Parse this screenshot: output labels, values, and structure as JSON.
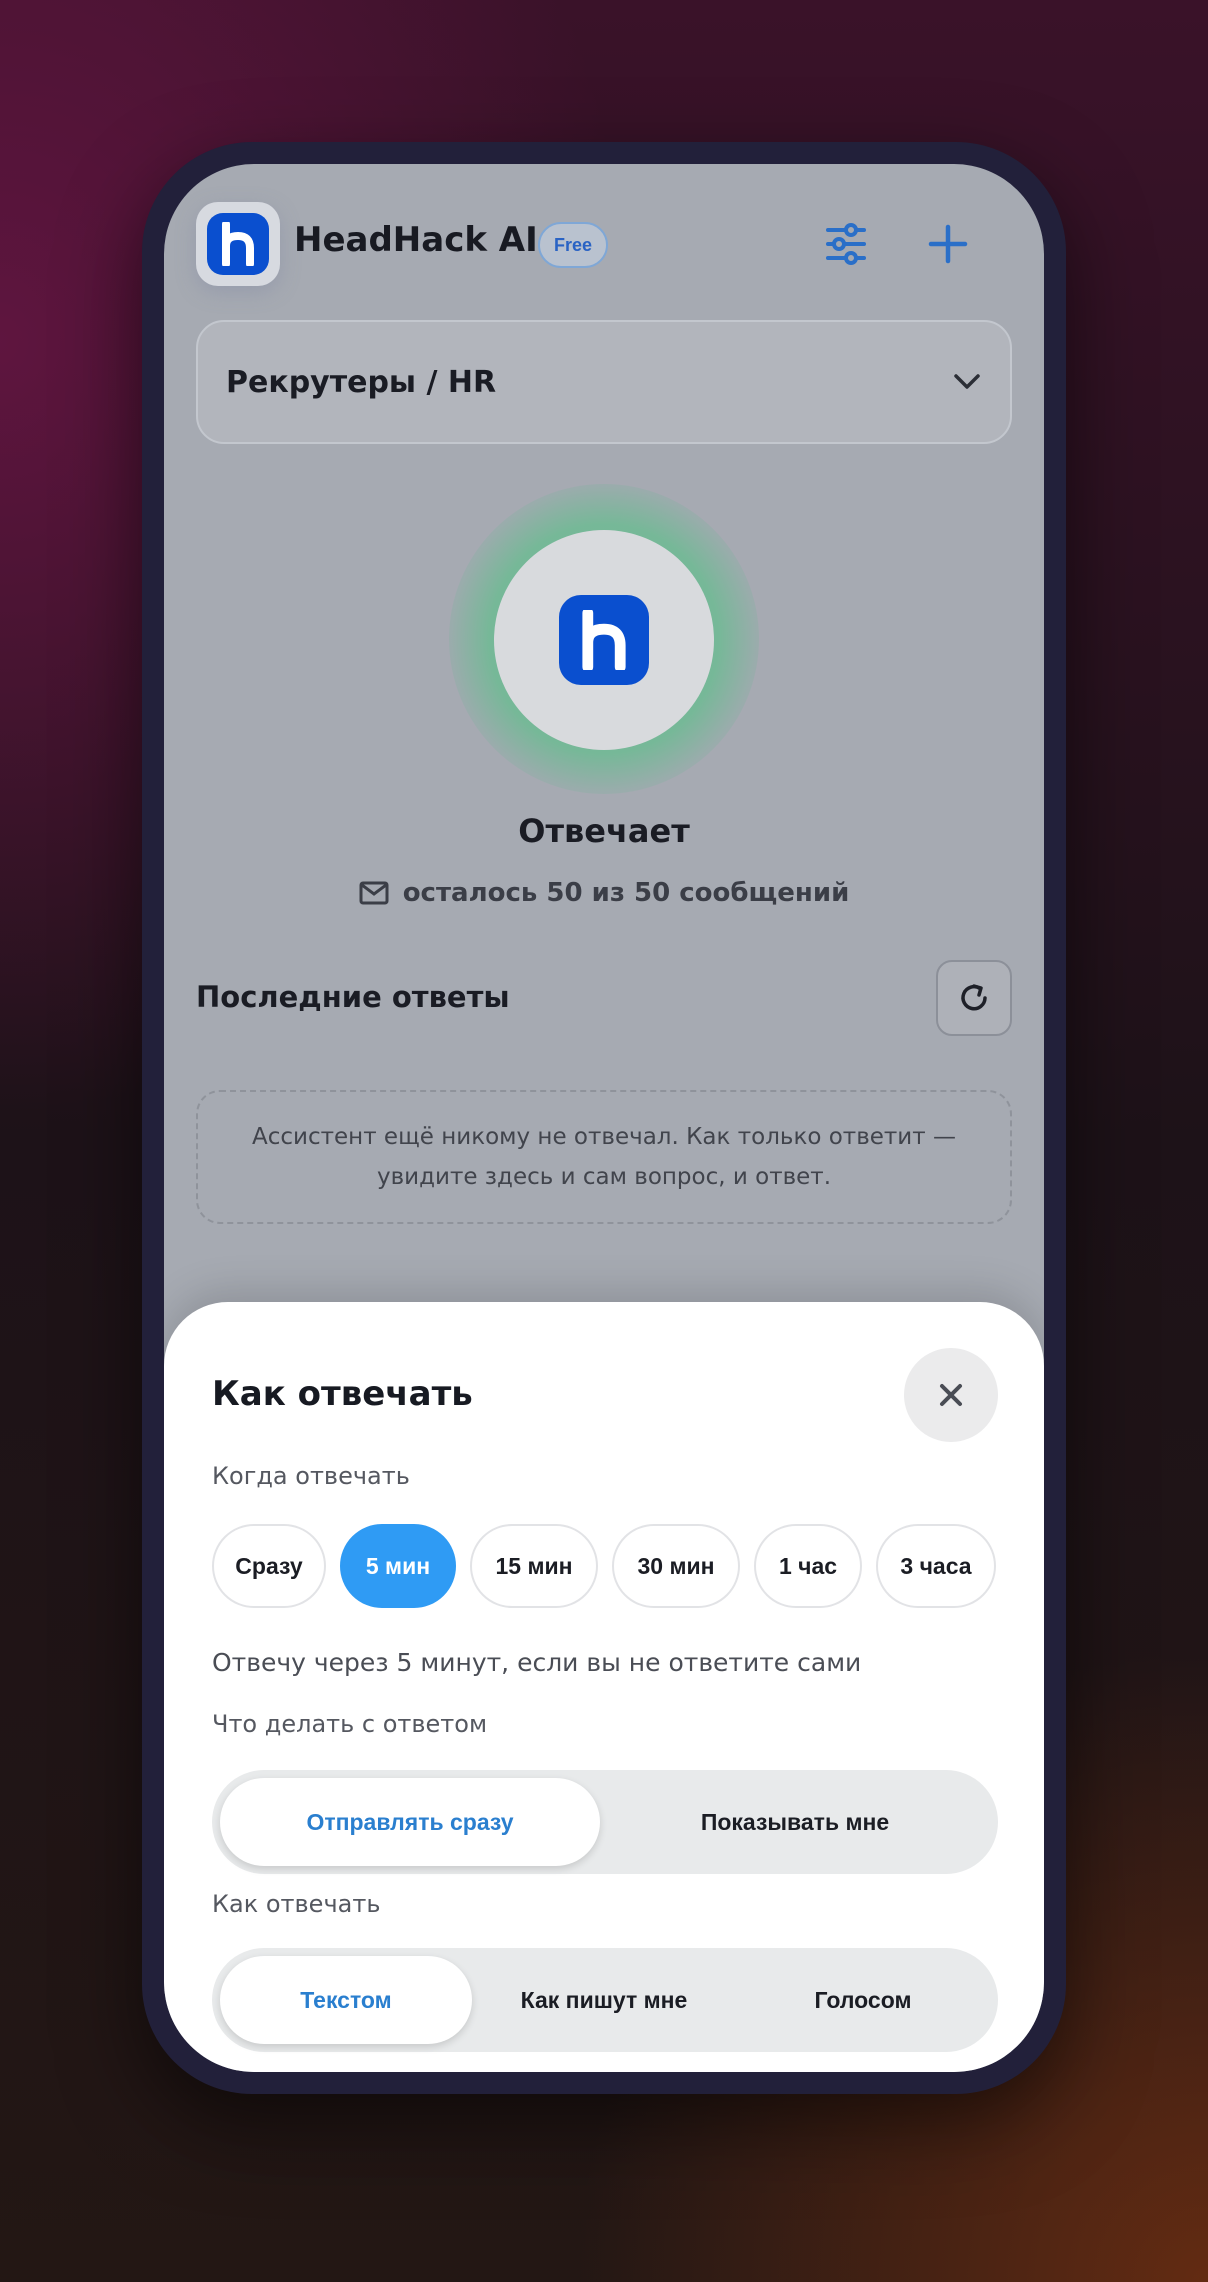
{
  "app": {
    "title": "HeadHack AI",
    "plan_badge": "Free",
    "logo_letter": "h"
  },
  "header": {
    "icons": [
      "settings-sliders-icon",
      "plus-icon"
    ]
  },
  "category_select": {
    "value": "Рекрутеры / HR",
    "icon": "chevron-down-icon"
  },
  "status": {
    "label": "Отвечает",
    "quota_text": "осталось 50 из 50 сообщений",
    "quota_icon": "mail-icon"
  },
  "recent": {
    "title": "Последние ответы",
    "refresh_icon": "refresh-icon",
    "empty_text": "Ассистент ещё никому не отвечал. Как только ответит — увидите здесь и сам вопрос, и ответ."
  },
  "sheet": {
    "title": "Как отвечать",
    "close_icon": "close-icon",
    "when_label": "Когда отвечать",
    "delay_options": [
      {
        "label": "Сразу",
        "selected": false
      },
      {
        "label": "5 мин",
        "selected": true
      },
      {
        "label": "15 мин",
        "selected": false
      },
      {
        "label": "30 мин",
        "selected": false
      },
      {
        "label": "1 час",
        "selected": false
      },
      {
        "label": "3 часа",
        "selected": false
      }
    ],
    "delay_hint": "Отвечу через 5 минут, если вы не ответите сами",
    "action_label": "Что делать с ответом",
    "action_options": [
      {
        "label": "Отправлять сразу",
        "selected": true
      },
      {
        "label": "Показывать мне",
        "selected": false
      }
    ],
    "style_label": "Как отвечать",
    "style_options": [
      {
        "label": "Текстом",
        "selected": true
      },
      {
        "label": "Как пишут мне",
        "selected": false
      },
      {
        "label": "Голосом",
        "selected": false
      }
    ]
  },
  "colors": {
    "brand_blue": "#0a4fcf",
    "accent_blue": "#2f9bf4",
    "status_green": "#73b996"
  }
}
